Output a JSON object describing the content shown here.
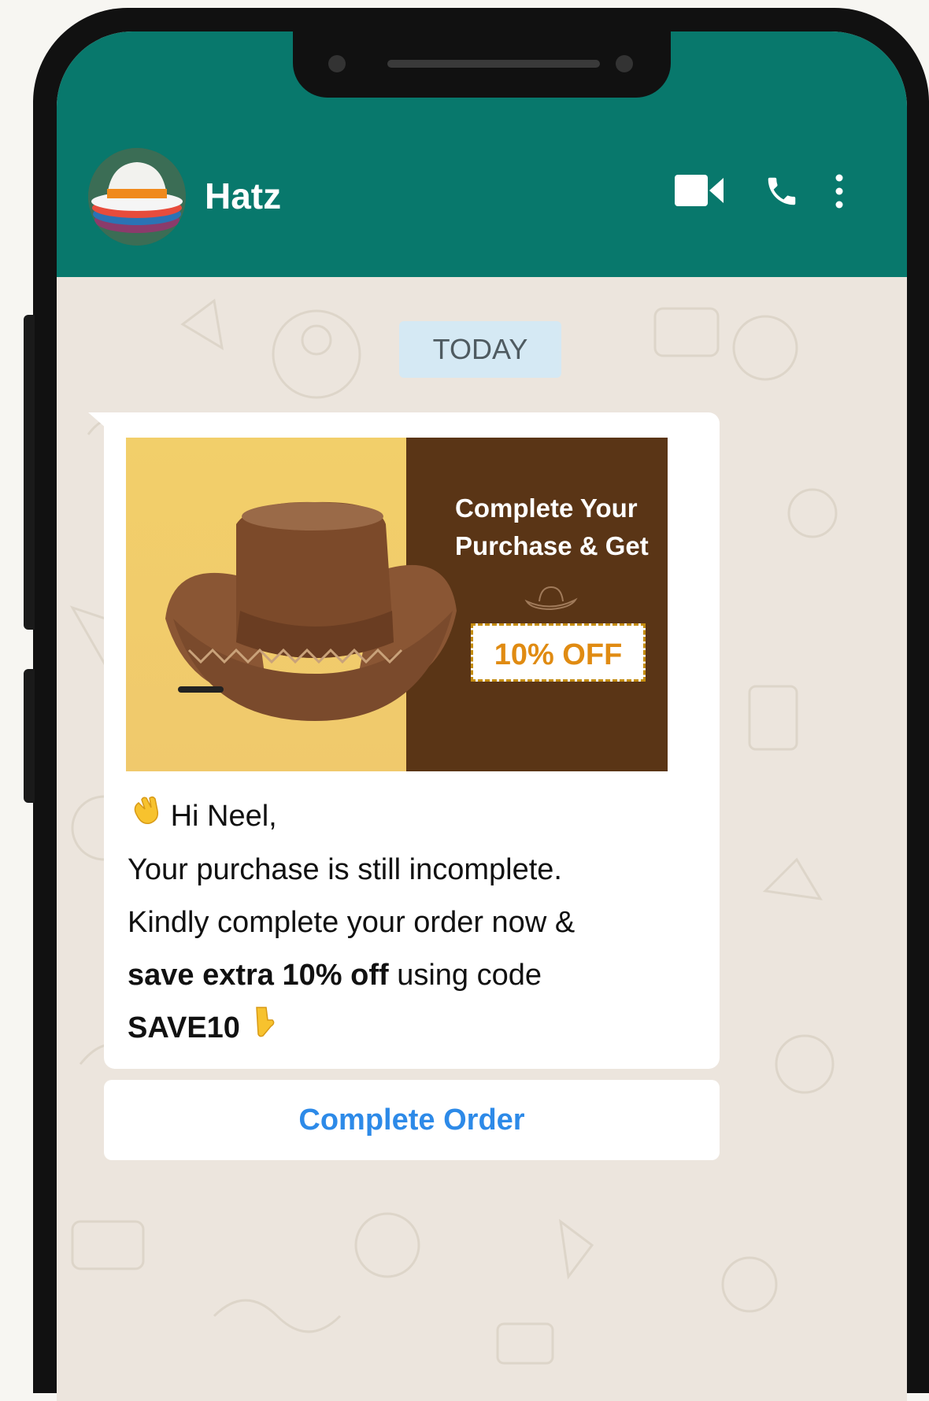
{
  "header": {
    "contact_name": "Hatz",
    "colors": {
      "bar": "#08786c",
      "icon": "#ffffff"
    },
    "icons": [
      "video-call-icon",
      "voice-call-icon",
      "more-vertical-icon"
    ]
  },
  "chat": {
    "date_chip": "TODAY",
    "banner": {
      "headline_line1": "Complete Your",
      "headline_line2": "Purchase & Get",
      "offer": "10% OFF"
    },
    "message": {
      "greeting": "Hi Neel,",
      "line1": "Your purchase is still incomplete.",
      "line2": "Kindly complete your order now &",
      "bold_text": "save extra 10% off",
      "line3_rest": " using code",
      "code": "SAVE10"
    },
    "cta_label": "Complete Order",
    "colors": {
      "cta": "#2d8ae8",
      "offer": "#e08b12"
    }
  }
}
